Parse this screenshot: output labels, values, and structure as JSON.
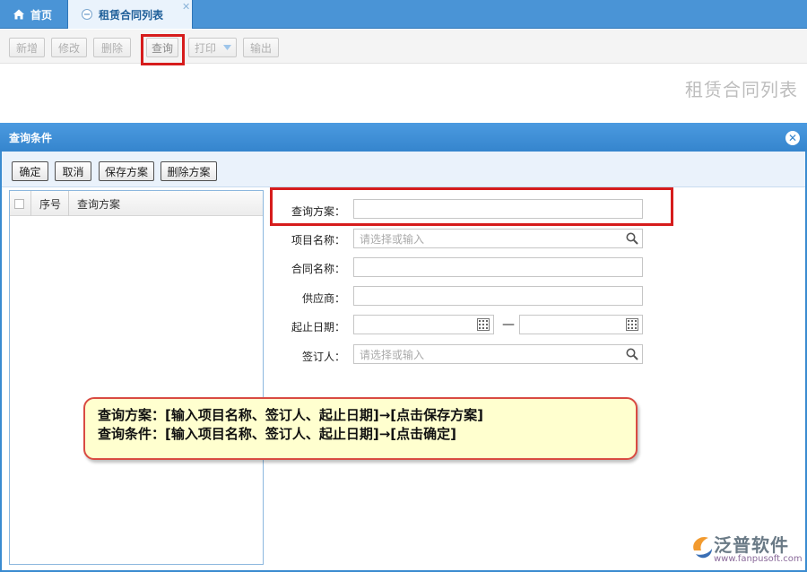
{
  "tabs": {
    "home": "首页",
    "lease_list": "租赁合同列表",
    "close": "✕"
  },
  "toolbar": {
    "add": "新增",
    "edit": "修改",
    "delete": "删除",
    "query": "查询",
    "print": "打印",
    "export": "输出"
  },
  "page_title": "租赁合同列表",
  "dialog": {
    "title": "查询条件",
    "buttons": {
      "confirm": "确定",
      "cancel": "取消",
      "save_scheme": "保存方案",
      "delete_scheme": "删除方案"
    },
    "list": {
      "col_seq": "序号",
      "col_scheme": "查询方案"
    },
    "form": {
      "scheme_label": "查询方案：",
      "scheme_value": "",
      "project_label": "项目名称：",
      "project_placeholder": "请选择或输入",
      "contract_label": "合同名称：",
      "contract_value": "",
      "supplier_label": "供应商：",
      "supplier_value": "",
      "date_label": "起止日期：",
      "date_start": "",
      "date_end": "",
      "date_sep": "—",
      "signer_label": "签订人：",
      "signer_placeholder": "请选择或输入"
    }
  },
  "callout": {
    "line1": "查询方案：[输入项目名称、签订人、起止日期]→[点击保存方案]",
    "line2": "查询条件：[输入项目名称、签订人、起止日期]→[点击确定]"
  },
  "logo": {
    "name": "泛普软件",
    "url": "www.fanpusoft.com"
  },
  "colors": {
    "accent": "#3a8bd0",
    "highlight": "#d61c1c",
    "callout_bg": "#ffffcf"
  }
}
